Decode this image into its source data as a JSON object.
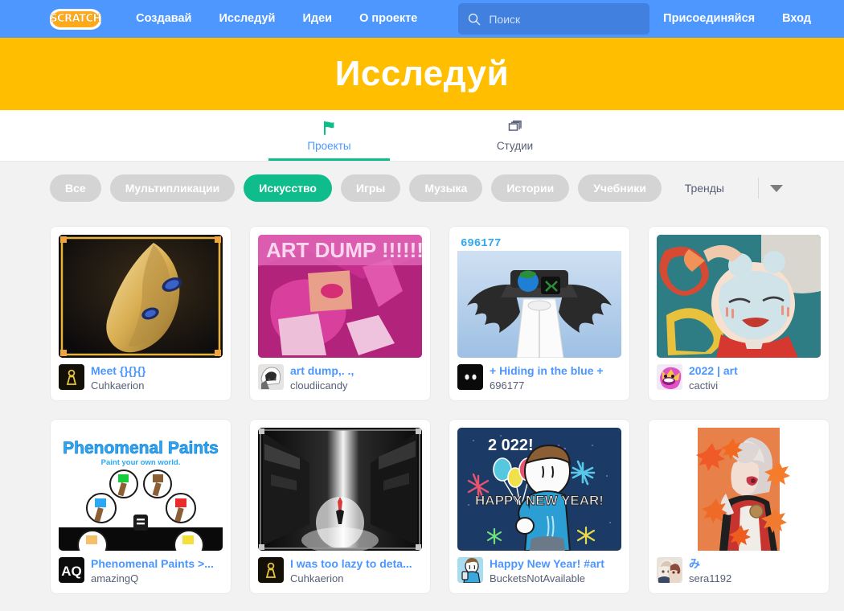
{
  "navbar": {
    "logo_text": "SCRATCH",
    "links": [
      {
        "label": "Создавай"
      },
      {
        "label": "Исследуй"
      },
      {
        "label": "Идеи"
      },
      {
        "label": "О проекте"
      }
    ],
    "search": {
      "placeholder": "Поиск",
      "value": "",
      "icon": "search-icon"
    },
    "right_links": [
      {
        "label": "Присоединяйся"
      },
      {
        "label": "Вход"
      }
    ],
    "background_color": "#4D97FF"
  },
  "hero": {
    "title": "Исследуй",
    "background_color": "#FFBF00"
  },
  "tabs": [
    {
      "label": "Проекты",
      "icon": "green-flag-icon",
      "active": true
    },
    {
      "label": "Студии",
      "icon": "studios-icon",
      "active": false
    }
  ],
  "filters": {
    "pills": [
      {
        "label": "Все",
        "active": false
      },
      {
        "label": "Мультипликации",
        "active": false
      },
      {
        "label": "Искусство",
        "active": true
      },
      {
        "label": "Игры",
        "active": false
      },
      {
        "label": "Музыка",
        "active": false
      },
      {
        "label": "Истории",
        "active": false
      },
      {
        "label": "Учебники",
        "active": false
      }
    ],
    "sort_label": "Тренды",
    "sort_icon": "chevron-down-icon",
    "active_color": "#0FBD8C",
    "inactive_color": "#D4D4D4"
  },
  "projects": [
    {
      "title": "Meet {}{}{}",
      "author": "Cuhkaerion",
      "thumbnail": "golden-dragon-head-dark",
      "avatar": "yellow-lampshade-on-black",
      "overlay_text": ""
    },
    {
      "title": "art dump,. .,",
      "author": "cloudiicandy",
      "thumbnail": "pink-art-dump-banner",
      "avatar": "anime-girl-sketch",
      "overlay_text": "ART DUMP !!!!!!!"
    },
    {
      "title": "+ Hiding in the blue +",
      "author": "696177",
      "thumbnail": "black-winged-character-blue-sky",
      "avatar": "black-cat-eyes",
      "overlay_text": "696177"
    },
    {
      "title": "2022 | art",
      "author": "cactivi",
      "thumbnail": "anime-girl-teal-pattern",
      "avatar": "pink-smiling-character",
      "overlay_text": ""
    },
    {
      "title": "Phenomenal Paints >...",
      "author": "amazingQ",
      "thumbnail": "phenomenal-paints-title",
      "avatar": "aq-monogram-black",
      "overlay_text": "Phenomenal Paints",
      "overlay_subtext": "Paint your own world."
    },
    {
      "title": "I was too lazy to deta...",
      "author": "Cuhkaerion",
      "thumbnail": "grayscale-alley-scene",
      "avatar": "yellow-lampshade-on-black",
      "overlay_text": ""
    },
    {
      "title": "Happy New Year! #art",
      "author": "BucketsNotAvailable",
      "thumbnail": "new-year-character-fireworks",
      "avatar": "blue-character-bucket",
      "overlay_text": "2022!",
      "overlay_subtext": "HAPPY NEW YEAR!"
    },
    {
      "title": "み",
      "author": "sera1192",
      "thumbnail": "anime-character-orange-maple",
      "avatar": "anime-duo-portrait",
      "overlay_text": ""
    }
  ]
}
